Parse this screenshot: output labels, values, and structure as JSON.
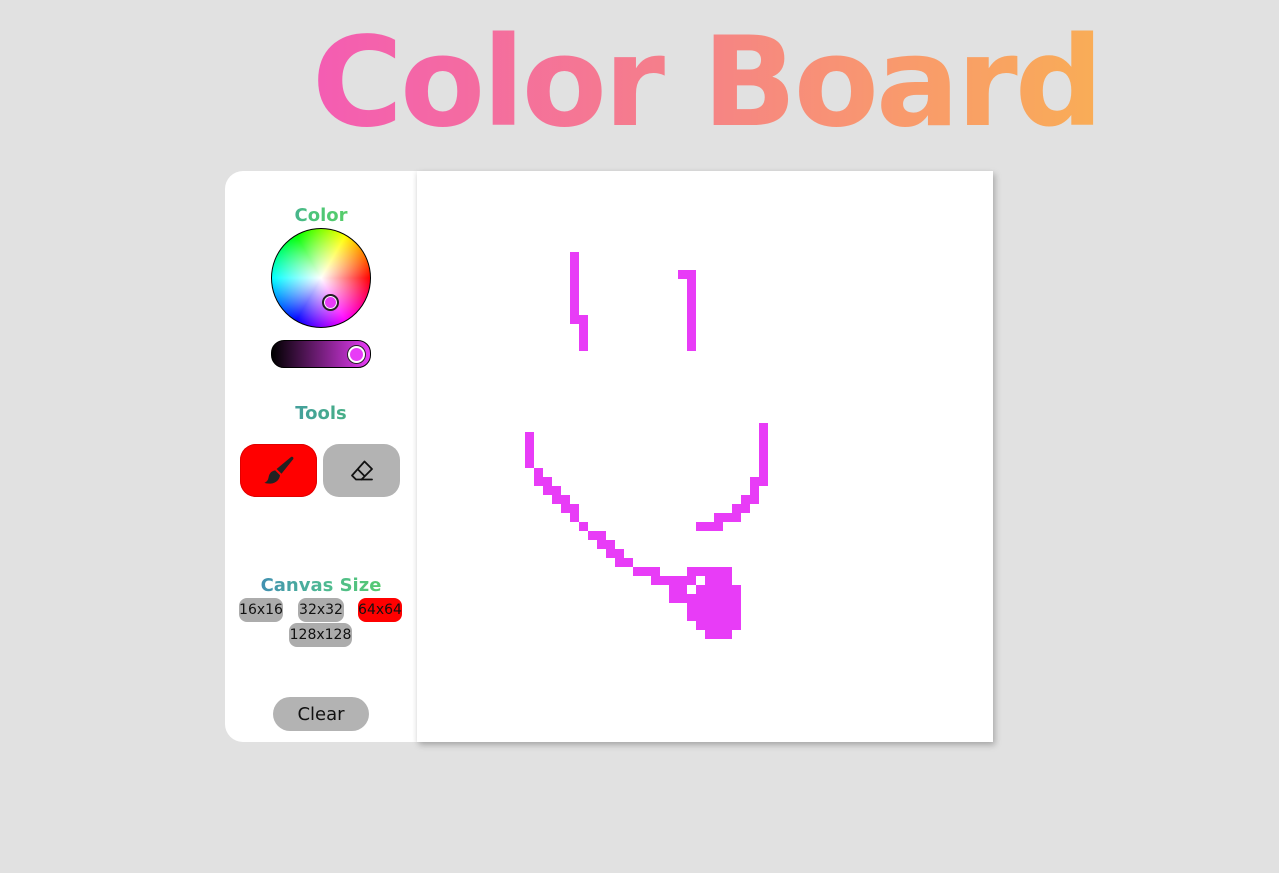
{
  "app": {
    "title": "Color Board"
  },
  "sidebar": {
    "color_title": "Color",
    "tools_title": "Tools",
    "canvas_size_title": "Canvas Size",
    "clear_label": "Clear"
  },
  "color_picker": {
    "selected_color": "#e83cf7",
    "brightness_percent": 96
  },
  "tools": [
    {
      "name": "brush",
      "icon": "paintbrush-icon",
      "active": true
    },
    {
      "name": "eraser",
      "icon": "eraser-icon",
      "active": false
    }
  ],
  "canvas_sizes": [
    {
      "label": "16x16",
      "active": false
    },
    {
      "label": "32x32",
      "active": false
    },
    {
      "label": "64x64",
      "active": true
    },
    {
      "label": "128x128",
      "active": false
    }
  ],
  "colors": {
    "background": "#e1e1e1",
    "panel": "#ffffff",
    "active_button": "#ff0000",
    "inactive_button": "#acacac",
    "paint": "#e83cf7"
  },
  "drawing": {
    "grid": 64,
    "paint_color": "#e83cf7",
    "painted_cells": [
      [
        17,
        9
      ],
      [
        17,
        10
      ],
      [
        17,
        11
      ],
      [
        17,
        12
      ],
      [
        17,
        13
      ],
      [
        17,
        14
      ],
      [
        17,
        15
      ],
      [
        17,
        16
      ],
      [
        18,
        16
      ],
      [
        18,
        17
      ],
      [
        18,
        18
      ],
      [
        18,
        19
      ],
      [
        29,
        11
      ],
      [
        30,
        11
      ],
      [
        30,
        12
      ],
      [
        30,
        13
      ],
      [
        30,
        14
      ],
      [
        30,
        15
      ],
      [
        30,
        16
      ],
      [
        30,
        17
      ],
      [
        30,
        18
      ],
      [
        30,
        19
      ],
      [
        12,
        29
      ],
      [
        12,
        30
      ],
      [
        12,
        31
      ],
      [
        12,
        32
      ],
      [
        13,
        33
      ],
      [
        13,
        34
      ],
      [
        14,
        34
      ],
      [
        14,
        35
      ],
      [
        15,
        35
      ],
      [
        15,
        36
      ],
      [
        16,
        36
      ],
      [
        16,
        37
      ],
      [
        17,
        37
      ],
      [
        17,
        38
      ],
      [
        18,
        39
      ],
      [
        19,
        40
      ],
      [
        20,
        40
      ],
      [
        20,
        41
      ],
      [
        21,
        41
      ],
      [
        21,
        42
      ],
      [
        22,
        42
      ],
      [
        22,
        43
      ],
      [
        23,
        43
      ],
      [
        24,
        44
      ],
      [
        25,
        44
      ],
      [
        26,
        44
      ],
      [
        26,
        45
      ],
      [
        27,
        45
      ],
      [
        28,
        45
      ],
      [
        29,
        45
      ],
      [
        38,
        28
      ],
      [
        38,
        29
      ],
      [
        38,
        30
      ],
      [
        38,
        31
      ],
      [
        38,
        32
      ],
      [
        38,
        33
      ],
      [
        38,
        34
      ],
      [
        37,
        34
      ],
      [
        37,
        35
      ],
      [
        37,
        36
      ],
      [
        36,
        36
      ],
      [
        36,
        37
      ],
      [
        35,
        37
      ],
      [
        35,
        38
      ],
      [
        34,
        38
      ],
      [
        33,
        38
      ],
      [
        33,
        39
      ],
      [
        32,
        39
      ],
      [
        31,
        39
      ],
      [
        30,
        44
      ],
      [
        31,
        44
      ],
      [
        32,
        44
      ],
      [
        33,
        44
      ],
      [
        34,
        44
      ],
      [
        30,
        45
      ],
      [
        32,
        45
      ],
      [
        33,
        45
      ],
      [
        34,
        45
      ],
      [
        28,
        46
      ],
      [
        29,
        46
      ],
      [
        31,
        46
      ],
      [
        32,
        46
      ],
      [
        33,
        46
      ],
      [
        34,
        46
      ],
      [
        35,
        46
      ],
      [
        28,
        47
      ],
      [
        29,
        47
      ],
      [
        30,
        47
      ],
      [
        31,
        47
      ],
      [
        32,
        47
      ],
      [
        33,
        47
      ],
      [
        34,
        47
      ],
      [
        35,
        47
      ],
      [
        30,
        48
      ],
      [
        31,
        48
      ],
      [
        32,
        48
      ],
      [
        33,
        48
      ],
      [
        34,
        48
      ],
      [
        35,
        48
      ],
      [
        30,
        49
      ],
      [
        31,
        49
      ],
      [
        32,
        49
      ],
      [
        33,
        49
      ],
      [
        34,
        49
      ],
      [
        35,
        49
      ],
      [
        31,
        50
      ],
      [
        32,
        50
      ],
      [
        33,
        50
      ],
      [
        34,
        50
      ],
      [
        35,
        50
      ],
      [
        32,
        51
      ],
      [
        33,
        51
      ],
      [
        34,
        51
      ]
    ]
  }
}
